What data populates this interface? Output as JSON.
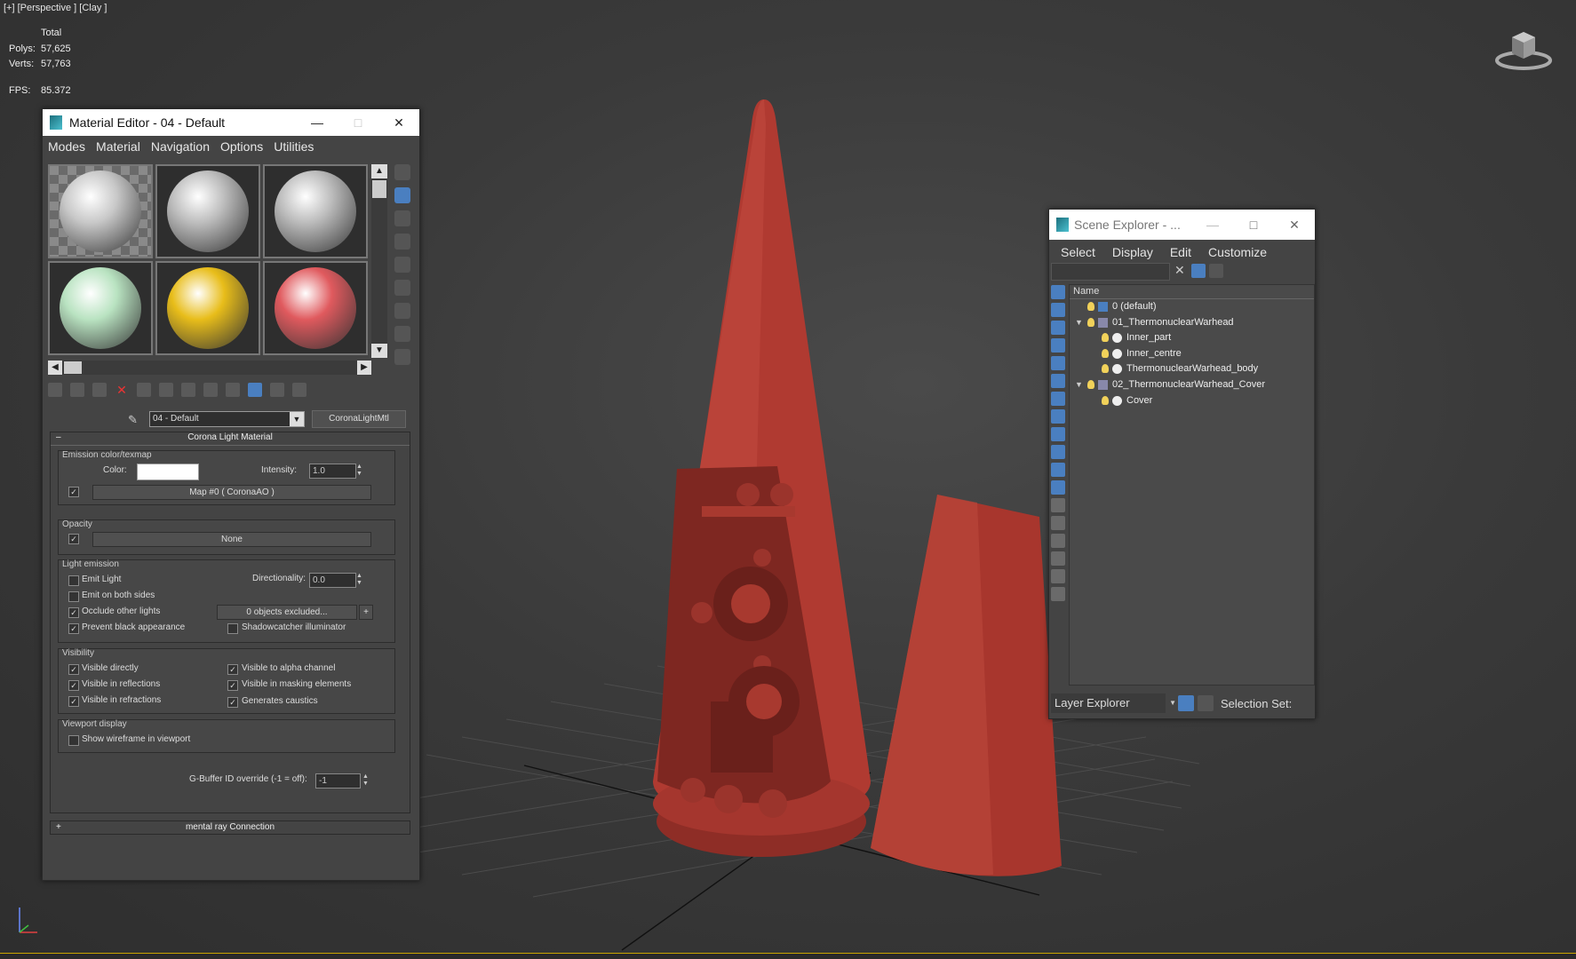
{
  "viewport": {
    "label": "[+] [Perspective ] [Clay ]",
    "stats": {
      "total_label": "Total",
      "polys_label": "Polys:",
      "polys": "57,625",
      "verts_label": "Verts:",
      "verts": "57,763",
      "fps_label": "FPS:",
      "fps": "85.372"
    },
    "model_color": "#b23c32"
  },
  "material_editor": {
    "title": "Material Editor - 04 - Default",
    "menu": [
      "Modes",
      "Material",
      "Navigation",
      "Options",
      "Utilities"
    ],
    "slots": [
      {
        "color": "#c8c8c8",
        "checker": true
      },
      {
        "color": "#bdbdbd",
        "checker": false
      },
      {
        "color": "#bcbcbc",
        "checker": false
      },
      {
        "color": "#b9e3c1",
        "checker": false
      },
      {
        "color": "#e8bd1a",
        "checker": false
      },
      {
        "color": "#e05a5e",
        "checker": false
      }
    ],
    "material_name": "04 - Default",
    "material_type": "CoronaLightMtl",
    "rollout_title": "Corona Light Material",
    "emission": {
      "group": "Emission color/texmap",
      "color_label": "Color:",
      "intensity_label": "Intensity:",
      "intensity": "1.0",
      "map_button": "Map #0  ( CoronaAO )"
    },
    "opacity": {
      "group": "Opacity",
      "map_button": "None"
    },
    "light_emission": {
      "group": "Light emission",
      "emit_light": "Emit Light",
      "directionality_label": "Directionality:",
      "directionality": "0.0",
      "emit_both": "Emit on both sides",
      "occlude": "Occlude other lights",
      "excluded": "0 objects excluded...",
      "prevent_black": "Prevent black appearance",
      "shadowcatcher": "Shadowcatcher illuminator"
    },
    "visibility": {
      "group": "Visibility",
      "directly": "Visible directly",
      "reflections": "Visible in reflections",
      "refractions": "Visible in refractions",
      "alpha": "Visible to alpha channel",
      "masking": "Visible in masking elements",
      "caustics": "Generates caustics"
    },
    "viewport_display": {
      "group": "Viewport display",
      "wireframe": "Show wireframe in viewport"
    },
    "gbuffer_label": "G-Buffer ID override (-1 = off):",
    "gbuffer": "-1",
    "mental_ray": "mental ray Connection"
  },
  "scene_explorer": {
    "title": "Scene Explorer - ...",
    "menu": [
      "Select",
      "Display",
      "Edit",
      "Customize"
    ],
    "column_name": "Name",
    "rows": [
      {
        "label": "0 (default)",
        "kind": "layer"
      },
      {
        "label": "01_ThermonuclearWarhead",
        "kind": "layer"
      },
      {
        "label": "Inner_part",
        "kind": "object"
      },
      {
        "label": "Inner_centre",
        "kind": "object"
      },
      {
        "label": "ThermonuclearWarhead_body",
        "kind": "object"
      },
      {
        "label": "02_ThermonuclearWarhead_Cover",
        "kind": "layer"
      },
      {
        "label": "Cover",
        "kind": "object"
      }
    ],
    "explorer_mode": "Layer Explorer",
    "selection_set": "Selection Set:"
  }
}
